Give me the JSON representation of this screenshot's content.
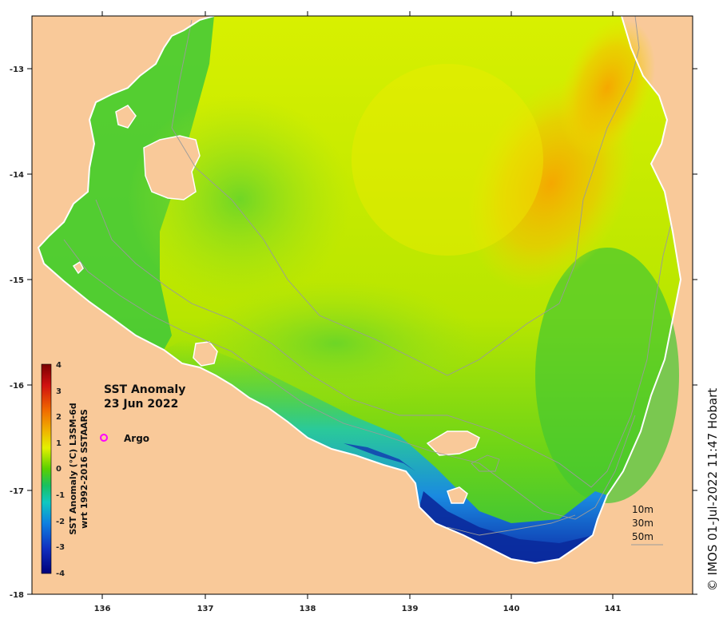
{
  "map": {
    "title_line1": "SST Anomaly",
    "title_line2": "23 Jun 2022",
    "legend_argo": "Argo",
    "colorbar_title_line1": "SST Anomaly (°C) L3SM-6d",
    "colorbar_title_line2": "wrt 1992-2016 SSTAARS",
    "colorbar_ticks": [
      "4",
      "3",
      "2",
      "1",
      "0",
      "-1",
      "-2",
      "-3",
      "-4"
    ],
    "depth_labels": [
      "10m",
      "30m",
      "50m"
    ],
    "credit": "© IMOS 01-Jul-2022 11:47 Hobart",
    "x_ticks": [
      "136",
      "137",
      "138",
      "139",
      "140",
      "141"
    ],
    "y_ticks": [
      "-13",
      "-14",
      "-15",
      "-16",
      "-17",
      "-18"
    ],
    "colors": {
      "land": "#f9c999",
      "argo_marker": "#ff00ff",
      "contour": "#9a9a9a"
    }
  }
}
